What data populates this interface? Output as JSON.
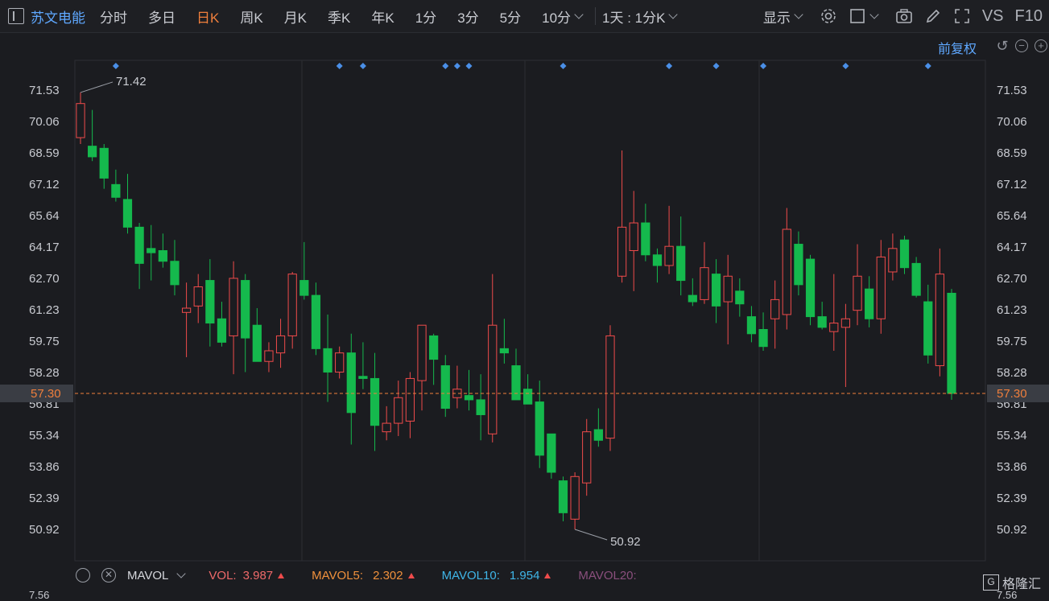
{
  "toolbar": {
    "stock_name": "苏文电能",
    "periods": [
      "分时",
      "多日",
      "日K",
      "周K",
      "月K",
      "季K",
      "年K",
      "1分",
      "3分",
      "5分",
      "10分"
    ],
    "active_period": "日K",
    "interval_select": "1天 : 1分K",
    "display_label": "显示",
    "vs_label": "VS",
    "f10_label": "F10"
  },
  "chart_header": {
    "adjust_label": "前复权"
  },
  "colors": {
    "up": "#ef4b4b",
    "down": "#15b94d",
    "current_price": "#f07f3c",
    "event_marker": "#4a8fe7",
    "accent": "#5fa8ff"
  },
  "chart_data": {
    "type": "candlestick",
    "price_axis_ticks": [
      "71.53",
      "70.06",
      "68.59",
      "67.12",
      "65.64",
      "64.17",
      "62.70",
      "61.23",
      "59.75",
      "58.28",
      "56.81",
      "55.34",
      "53.86",
      "52.39",
      "50.92"
    ],
    "ylim": [
      50.92,
      71.53
    ],
    "current_price": "57.30",
    "high_label": "71.42",
    "low_label": "50.92",
    "event_marker_candle_indexes": [
      3,
      22,
      24,
      31,
      32,
      33,
      41,
      50,
      54,
      58,
      65,
      72
    ],
    "candles": [
      {
        "o": 69.3,
        "h": 71.42,
        "l": 69.0,
        "c": 70.9
      },
      {
        "o": 68.9,
        "h": 70.6,
        "l": 68.2,
        "c": 68.4
      },
      {
        "o": 68.8,
        "h": 69.0,
        "l": 66.9,
        "c": 67.4
      },
      {
        "o": 67.1,
        "h": 67.8,
        "l": 66.3,
        "c": 66.5
      },
      {
        "o": 66.4,
        "h": 67.6,
        "l": 64.8,
        "c": 65.1
      },
      {
        "o": 65.1,
        "h": 65.3,
        "l": 62.2,
        "c": 63.4
      },
      {
        "o": 64.1,
        "h": 65.2,
        "l": 62.6,
        "c": 63.9
      },
      {
        "o": 64.0,
        "h": 64.8,
        "l": 63.2,
        "c": 63.5
      },
      {
        "o": 63.5,
        "h": 64.5,
        "l": 61.9,
        "c": 62.4
      },
      {
        "o": 61.1,
        "h": 62.5,
        "l": 59.0,
        "c": 61.3
      },
      {
        "o": 61.4,
        "h": 62.9,
        "l": 60.6,
        "c": 62.3
      },
      {
        "o": 62.6,
        "h": 63.6,
        "l": 59.5,
        "c": 60.6
      },
      {
        "o": 60.8,
        "h": 61.6,
        "l": 59.5,
        "c": 59.7
      },
      {
        "o": 60.0,
        "h": 63.5,
        "l": 58.2,
        "c": 62.7
      },
      {
        "o": 62.6,
        "h": 62.9,
        "l": 58.3,
        "c": 59.9
      },
      {
        "o": 60.5,
        "h": 61.3,
        "l": 58.9,
        "c": 58.8
      },
      {
        "o": 58.8,
        "h": 59.7,
        "l": 58.3,
        "c": 59.3
      },
      {
        "o": 59.2,
        "h": 60.8,
        "l": 58.5,
        "c": 60.0
      },
      {
        "o": 60.0,
        "h": 63.0,
        "l": 59.4,
        "c": 62.9
      },
      {
        "o": 62.6,
        "h": 64.4,
        "l": 61.7,
        "c": 61.9
      },
      {
        "o": 61.9,
        "h": 62.5,
        "l": 59.1,
        "c": 59.4
      },
      {
        "o": 59.4,
        "h": 61.0,
        "l": 56.9,
        "c": 58.3
      },
      {
        "o": 58.3,
        "h": 59.5,
        "l": 58.0,
        "c": 59.2
      },
      {
        "o": 59.2,
        "h": 60.1,
        "l": 54.9,
        "c": 56.4
      },
      {
        "o": 58.1,
        "h": 59.7,
        "l": 57.5,
        "c": 58.0
      },
      {
        "o": 58.0,
        "h": 59.2,
        "l": 54.6,
        "c": 55.8
      },
      {
        "o": 55.5,
        "h": 56.7,
        "l": 55.1,
        "c": 55.9
      },
      {
        "o": 55.9,
        "h": 57.9,
        "l": 55.3,
        "c": 57.1
      },
      {
        "o": 56.0,
        "h": 58.3,
        "l": 55.2,
        "c": 58.0
      },
      {
        "o": 57.9,
        "h": 58.7,
        "l": 56.5,
        "c": 60.5
      },
      {
        "o": 60.0,
        "h": 60.1,
        "l": 57.7,
        "c": 58.9
      },
      {
        "o": 58.6,
        "h": 59.1,
        "l": 56.2,
        "c": 56.6
      },
      {
        "o": 57.1,
        "h": 58.6,
        "l": 56.6,
        "c": 57.5
      },
      {
        "o": 57.2,
        "h": 58.4,
        "l": 56.5,
        "c": 57.0
      },
      {
        "o": 57.0,
        "h": 58.2,
        "l": 55.1,
        "c": 56.3
      },
      {
        "o": 55.4,
        "h": 62.9,
        "l": 55.0,
        "c": 60.5
      },
      {
        "o": 59.4,
        "h": 60.8,
        "l": 58.7,
        "c": 59.2
      },
      {
        "o": 58.6,
        "h": 59.4,
        "l": 57.3,
        "c": 57.0
      },
      {
        "o": 57.5,
        "h": 58.2,
        "l": 56.8,
        "c": 56.8
      },
      {
        "o": 56.9,
        "h": 57.9,
        "l": 53.8,
        "c": 54.4
      },
      {
        "o": 55.4,
        "h": 55.4,
        "l": 53.3,
        "c": 53.6
      },
      {
        "o": 53.2,
        "h": 53.4,
        "l": 51.3,
        "c": 51.7
      },
      {
        "o": 51.4,
        "h": 53.6,
        "l": 50.92,
        "c": 53.4
      },
      {
        "o": 53.1,
        "h": 56.1,
        "l": 52.5,
        "c": 55.5
      },
      {
        "o": 55.6,
        "h": 56.6,
        "l": 54.8,
        "c": 55.1
      },
      {
        "o": 55.2,
        "h": 60.5,
        "l": 54.6,
        "c": 60.0
      },
      {
        "o": 62.8,
        "h": 68.7,
        "l": 62.5,
        "c": 65.1
      },
      {
        "o": 64.0,
        "h": 66.8,
        "l": 62.1,
        "c": 65.3
      },
      {
        "o": 65.3,
        "h": 66.2,
        "l": 63.5,
        "c": 63.8
      },
      {
        "o": 63.8,
        "h": 64.1,
        "l": 62.5,
        "c": 63.3
      },
      {
        "o": 63.3,
        "h": 66.1,
        "l": 62.9,
        "c": 64.2
      },
      {
        "o": 64.2,
        "h": 65.6,
        "l": 61.9,
        "c": 62.6
      },
      {
        "o": 61.9,
        "h": 62.7,
        "l": 61.4,
        "c": 61.6
      },
      {
        "o": 61.7,
        "h": 64.4,
        "l": 61.5,
        "c": 63.2
      },
      {
        "o": 62.9,
        "h": 63.6,
        "l": 60.6,
        "c": 61.4
      },
      {
        "o": 61.6,
        "h": 63.8,
        "l": 59.6,
        "c": 62.8
      },
      {
        "o": 62.1,
        "h": 62.7,
        "l": 60.9,
        "c": 61.5
      },
      {
        "o": 60.9,
        "h": 61.4,
        "l": 59.7,
        "c": 60.1
      },
      {
        "o": 60.3,
        "h": 61.1,
        "l": 59.3,
        "c": 59.5
      },
      {
        "o": 60.8,
        "h": 62.6,
        "l": 59.4,
        "c": 61.7
      },
      {
        "o": 61.0,
        "h": 66.0,
        "l": 60.3,
        "c": 65.0
      },
      {
        "o": 64.3,
        "h": 64.9,
        "l": 61.9,
        "c": 62.4
      },
      {
        "o": 63.6,
        "h": 63.8,
        "l": 60.5,
        "c": 60.9
      },
      {
        "o": 60.9,
        "h": 61.6,
        "l": 60.3,
        "c": 60.4
      },
      {
        "o": 60.2,
        "h": 62.9,
        "l": 59.3,
        "c": 60.6
      },
      {
        "o": 60.4,
        "h": 61.5,
        "l": 57.6,
        "c": 60.8
      },
      {
        "o": 61.2,
        "h": 64.3,
        "l": 60.5,
        "c": 62.8
      },
      {
        "o": 62.2,
        "h": 62.8,
        "l": 60.4,
        "c": 60.8
      },
      {
        "o": 60.8,
        "h": 64.5,
        "l": 60.1,
        "c": 63.7
      },
      {
        "o": 63.0,
        "h": 64.8,
        "l": 62.6,
        "c": 64.1
      },
      {
        "o": 64.5,
        "h": 64.7,
        "l": 62.9,
        "c": 63.2
      },
      {
        "o": 63.4,
        "h": 63.7,
        "l": 61.8,
        "c": 61.9
      },
      {
        "o": 61.6,
        "h": 62.4,
        "l": 58.7,
        "c": 59.1
      },
      {
        "o": 58.6,
        "h": 64.1,
        "l": 58.1,
        "c": 62.9
      },
      {
        "o": 62.0,
        "h": 62.2,
        "l": 57.0,
        "c": 57.3
      }
    ]
  },
  "volume_legend": {
    "settings_icon": "gear-icon",
    "close_icon": "close-icon",
    "indicator": "MAVOL",
    "vol_label": "VOL:",
    "vol_value": "3.987",
    "mavol5_label": "MAVOL5:",
    "mavol5_value": "2.302",
    "mavol10_label": "MAVOL10:",
    "mavol10_value": "1.954",
    "mavol20_label": "MAVOL20:",
    "vol_axis_top": "7.56"
  },
  "watermark": "格隆汇"
}
